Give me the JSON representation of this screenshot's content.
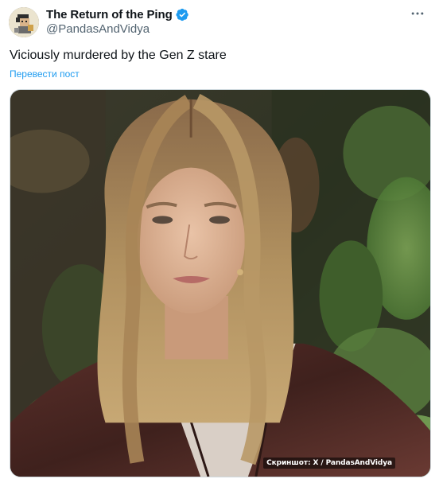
{
  "author": {
    "display_name": "The Return of the Ping",
    "handle": "@PandasAndVidya",
    "verified": true,
    "verified_color": "#1d9bf0",
    "avatar_icon": "pixel-character-avatar"
  },
  "tweet": {
    "text": "Viciously murdered by the Gen Z stare",
    "translate_label": "Перевести пост"
  },
  "media": {
    "watermark": "Скриншот: X / PandasAndVidya"
  },
  "colors": {
    "accent": "#1d9bf0",
    "secondary_text": "#536471",
    "primary_text": "#0f1419"
  }
}
